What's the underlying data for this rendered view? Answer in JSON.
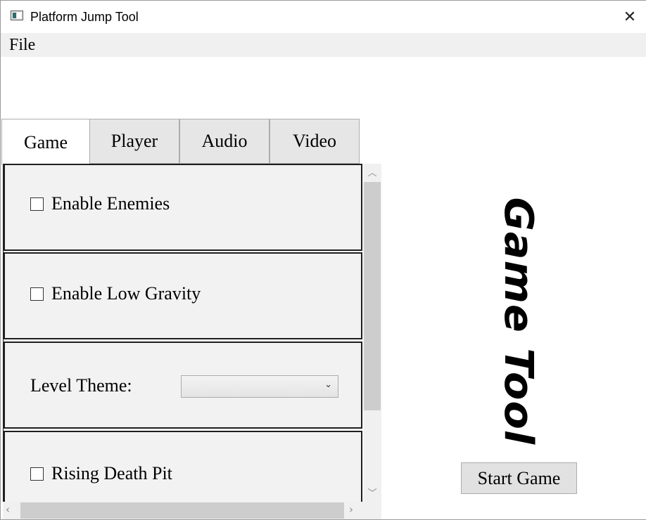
{
  "window": {
    "title": "Platform Jump Tool"
  },
  "menu": {
    "file": "File"
  },
  "tabs": [
    {
      "label": "Game",
      "active": true
    },
    {
      "label": "Player",
      "active": false
    },
    {
      "label": "Audio",
      "active": false
    },
    {
      "label": "Video",
      "active": false
    }
  ],
  "game_tab": {
    "enable_enemies": {
      "label": "Enable Enemies",
      "checked": false
    },
    "enable_low_gravity": {
      "label": "Enable Low Gravity",
      "checked": false
    },
    "level_theme": {
      "label": "Level Theme:",
      "value": ""
    },
    "rising_death_pit": {
      "label": "Rising Death Pit",
      "checked": false
    }
  },
  "logo": {
    "text": "Game Tool"
  },
  "start_button": {
    "label": "Start Game"
  },
  "icons": {
    "close": "close-icon",
    "app": "app-icon"
  }
}
